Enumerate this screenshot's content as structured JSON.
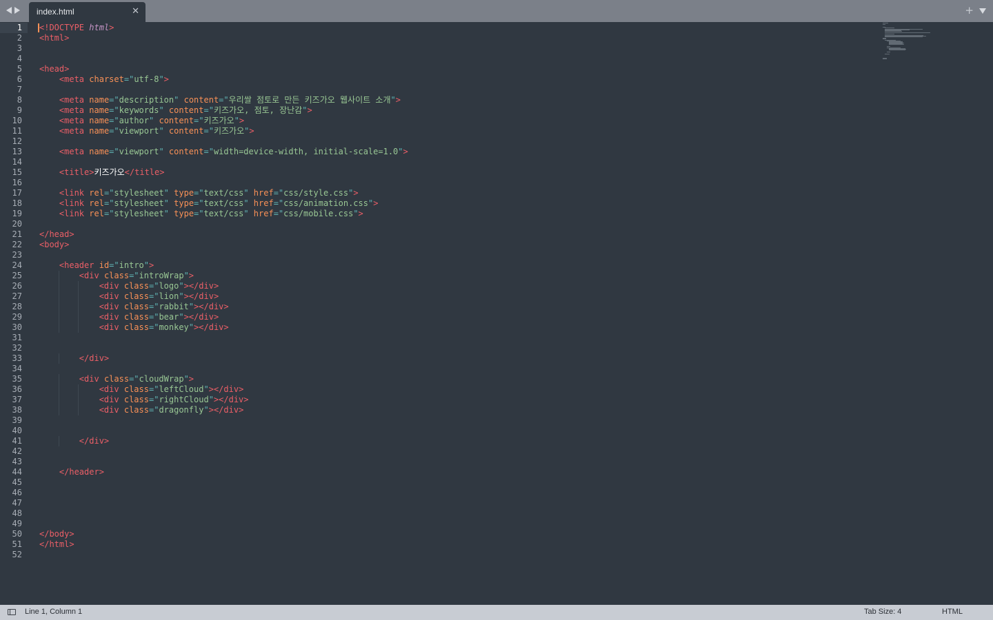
{
  "tab": {
    "title": "index.html",
    "close_icon": "close-icon"
  },
  "status": {
    "position": "Line 1, Column 1",
    "tab_size": "Tab Size: 4",
    "syntax": "HTML"
  },
  "editor": {
    "active_line": 1,
    "lines": [
      "<!DOCTYPE html>",
      "<html>",
      "",
      "",
      "<head>",
      "    <meta charset=\"utf-8\">",
      "",
      "    <meta name=\"description\" content=\"우리쌀 점토로 만든 키즈가오 웹사이트 소개\">",
      "    <meta name=\"keywords\" content=\"키즈가오, 점토, 장난감\">",
      "    <meta name=\"author\" content=\"키즈가오\">",
      "    <meta name=\"viewport\" content=\"키즈가오\">",
      "",
      "    <meta name=\"viewport\" content=\"width=device-width, initial-scale=1.0\">",
      "",
      "    <title>키즈가오</title>",
      "",
      "    <link rel=\"stylesheet\" type=\"text/css\" href=\"css/style.css\">",
      "    <link rel=\"stylesheet\" type=\"text/css\" href=\"css/animation.css\">",
      "    <link rel=\"stylesheet\" type=\"text/css\" href=\"css/mobile.css\">",
      "",
      "</head>",
      "<body>",
      "",
      "    <header id=\"intro\">",
      "        <div class=\"introWrap\">",
      "            <div class=\"logo\"></div>",
      "            <div class=\"lion\"></div>",
      "            <div class=\"rabbit\"></div>",
      "            <div class=\"bear\"></div>",
      "            <div class=\"monkey\"></div>",
      "",
      "",
      "        </div>",
      "",
      "        <div class=\"cloudWrap\">",
      "            <div class=\"leftCloud\"></div>",
      "            <div class=\"rightCloud\"></div>",
      "            <div class=\"dragonfly\"></div>",
      "",
      "",
      "        </div>",
      "",
      "",
      "    </header>",
      "",
      "",
      "",
      "",
      "",
      "</body>",
      "</html>",
      ""
    ]
  },
  "colors": {
    "background": "#303841",
    "tag": "#ec5f67",
    "attribute": "#f99157",
    "string": "#99c794",
    "punctuation": "#5fb3b3",
    "status_bar": "#c8ccd3"
  }
}
